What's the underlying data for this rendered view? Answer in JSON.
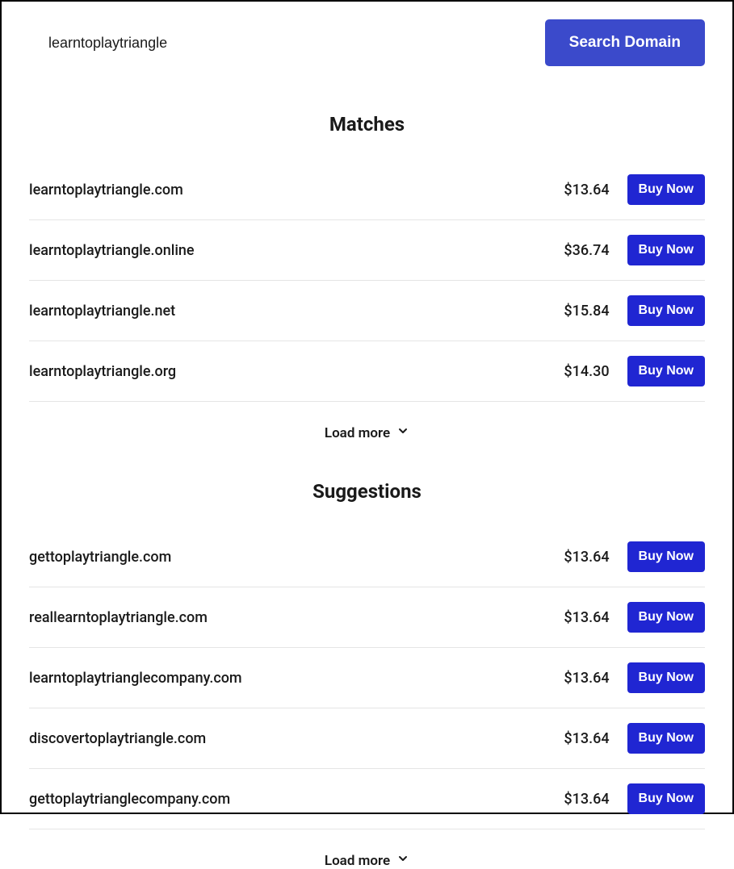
{
  "search": {
    "value": "learntoplaytriangle",
    "button_label": "Search Domain"
  },
  "sections": {
    "matches": {
      "title": "Matches",
      "load_more_label": "Load more",
      "items": [
        {
          "domain": "learntoplaytriangle.com",
          "price": "$13.64",
          "buy_label": "Buy Now"
        },
        {
          "domain": "learntoplaytriangle.online",
          "price": "$36.74",
          "buy_label": "Buy Now"
        },
        {
          "domain": "learntoplaytriangle.net",
          "price": "$15.84",
          "buy_label": "Buy Now"
        },
        {
          "domain": "learntoplaytriangle.org",
          "price": "$14.30",
          "buy_label": "Buy Now"
        }
      ]
    },
    "suggestions": {
      "title": "Suggestions",
      "load_more_label": "Load more",
      "items": [
        {
          "domain": "gettoplaytriangle.com",
          "price": "$13.64",
          "buy_label": "Buy Now"
        },
        {
          "domain": "reallearntoplaytriangle.com",
          "price": "$13.64",
          "buy_label": "Buy Now"
        },
        {
          "domain": "learntoplaytrianglecompany.com",
          "price": "$13.64",
          "buy_label": "Buy Now"
        },
        {
          "domain": "discovertoplaytriangle.com",
          "price": "$13.64",
          "buy_label": "Buy Now"
        },
        {
          "domain": "gettoplaytrianglecompany.com",
          "price": "$13.64",
          "buy_label": "Buy Now"
        }
      ]
    }
  }
}
